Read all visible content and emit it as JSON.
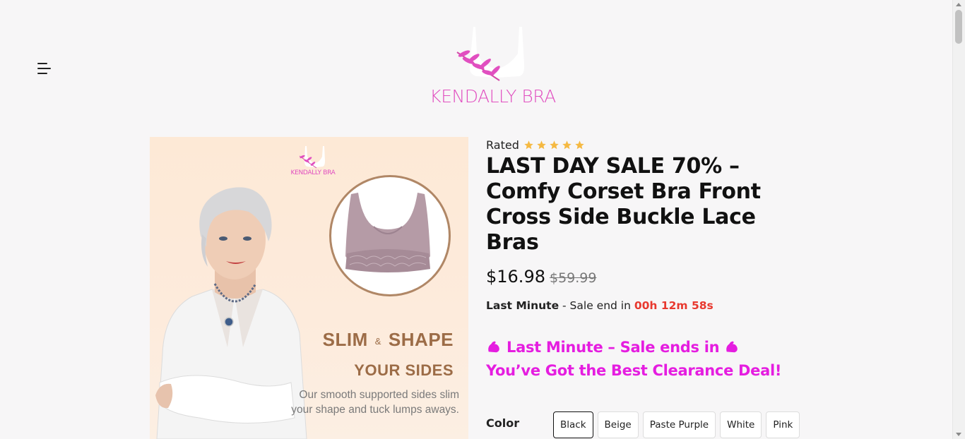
{
  "header": {
    "menu_icon": "hamburger-menu-icon",
    "logo_text": "KENDALLY BRA",
    "brand_color": "#e14fc0"
  },
  "product_image": {
    "logo_text": "KENDALLY BRA",
    "headline_slim": "SLIM",
    "headline_amp": "&",
    "headline_shape": "SHAPE",
    "headline_sides": "YOUR SIDES",
    "description": "Our smooth supported sides slim your shape and tuck lumps aways."
  },
  "product": {
    "rated_label": "Rated",
    "rating_stars": 5,
    "star_color": "#f5b942",
    "title": "LAST DAY SALE 70% – Comfy Corset Bra Front Cross Side Buckle Lace Bras",
    "price": "$16.98",
    "old_price": "$59.99",
    "countdown": {
      "label": "Last Minute",
      "text": " - Sale end in ",
      "timer": "00h 12m 58s",
      "timer_color": "#e8392f"
    },
    "promo": {
      "line1": "Last Minute – Sale ends in",
      "line2": "You’ve Got the Best Clearance Deal!",
      "color": "#e51de0",
      "icon": "flexed-biceps-icon"
    },
    "color_label": "Color",
    "color_options": [
      "Black",
      "Beige",
      "Paste Purple",
      "White",
      "Pink"
    ],
    "selected_color": "Black"
  }
}
